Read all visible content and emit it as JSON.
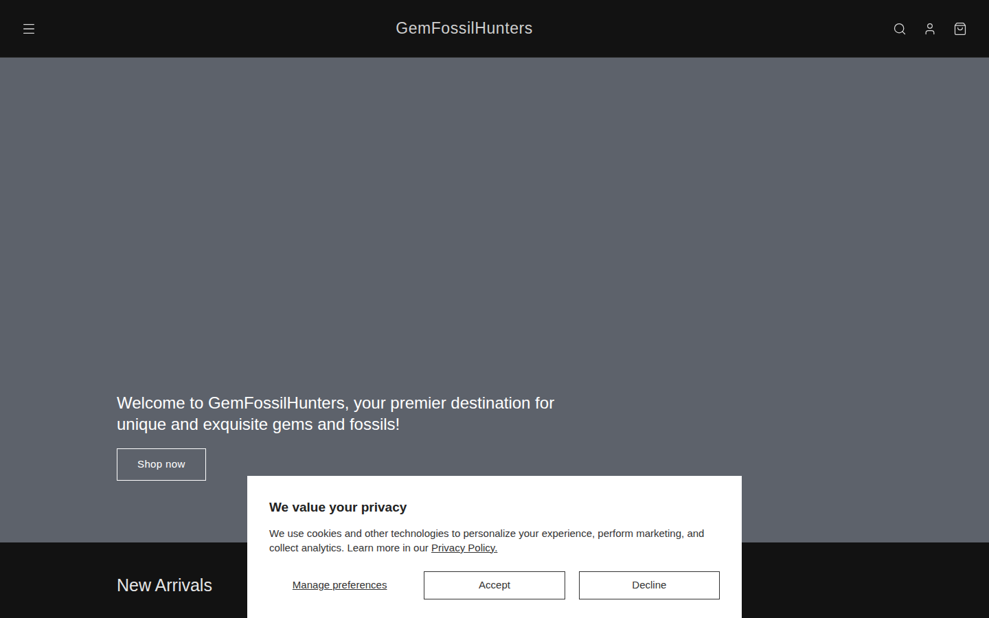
{
  "header": {
    "title": "GemFossilHunters"
  },
  "hero": {
    "heading": "Welcome to GemFossilHunters, your premier destination for unique and exquisite gems and fossils!",
    "button": "Shop now"
  },
  "section": {
    "title": "New Arrivals"
  },
  "cookie_banner": {
    "title": "We value your privacy",
    "text": "We use cookies and other technologies to personalize your experience, perform marketing, and collect analytics. Learn more in our ",
    "link": "Privacy Policy.",
    "buttons": [
      "Manage preferences",
      "Accept",
      "Decline"
    ]
  }
}
